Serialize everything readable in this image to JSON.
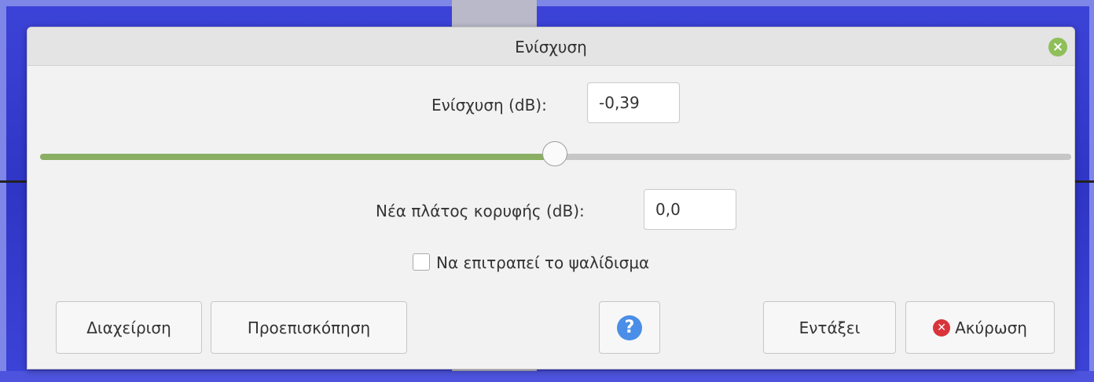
{
  "dialog": {
    "title": "Ενίσχυση",
    "close_icon": "close-icon"
  },
  "amplification": {
    "label": "Ενίσχυση (dB):",
    "value": "-0,39"
  },
  "slider": {
    "level_fraction": 0.499
  },
  "peak": {
    "label": "Νέα πλάτος κορυφής (dB):",
    "value": "0,0"
  },
  "clipping": {
    "label": "Να επιτραπεί το ψαλίδισμα",
    "checked": false
  },
  "buttons": {
    "manage": "Διαχείριση",
    "preview": "Προεπισκόπηση",
    "help_icon": "help-icon",
    "ok": "Εντάξει",
    "cancel": "Ακύρωση",
    "cancel_icon": "cancel-icon"
  },
  "colors": {
    "slider_fill": "#8aaf62",
    "help_icon": "#4a8ee8",
    "cancel_icon": "#d9343a",
    "close_icon": "#8fbf5a"
  }
}
